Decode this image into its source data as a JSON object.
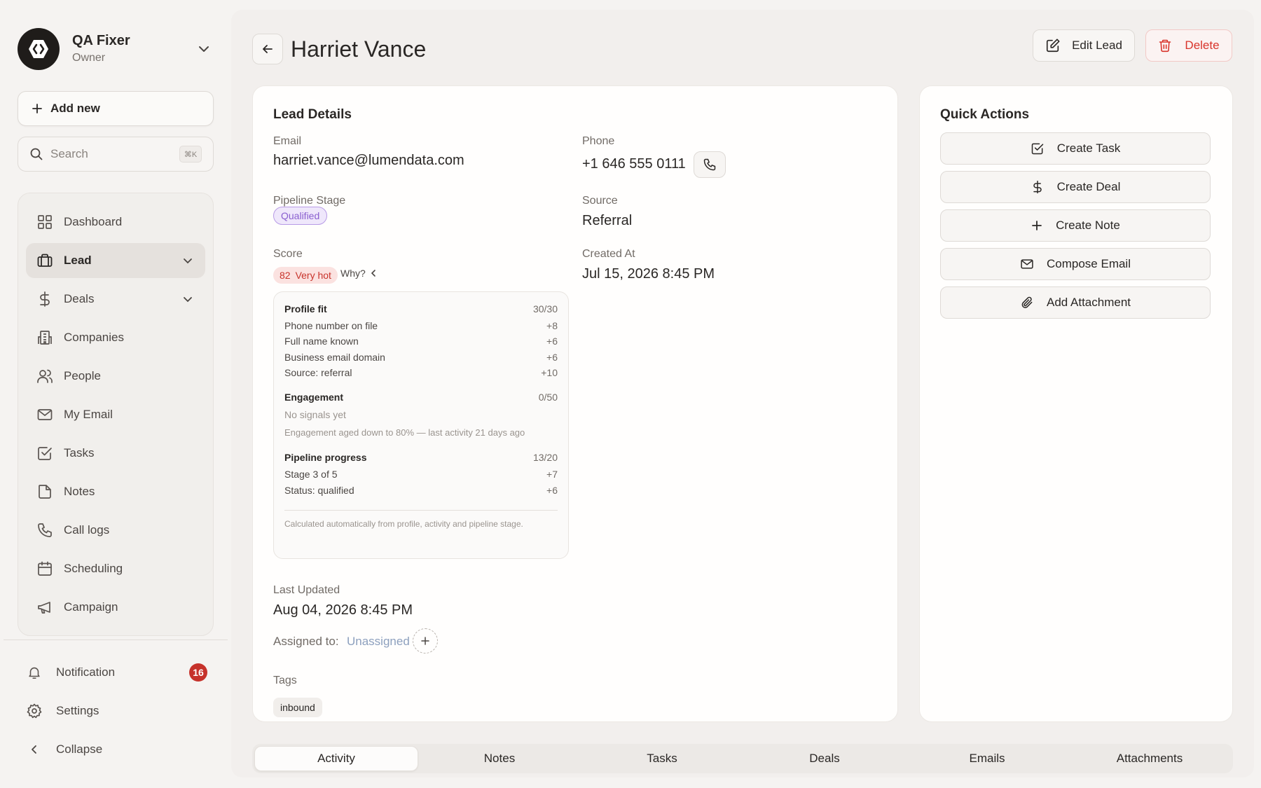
{
  "workspace": {
    "name": "QA Fixer",
    "role": "Owner"
  },
  "sidebar": {
    "add_new_label": "Add new",
    "search_placeholder": "Search",
    "search_shortcut": "⌘K",
    "items": [
      {
        "label": "Dashboard",
        "icon": "dashboard-icon"
      },
      {
        "label": "Lead",
        "icon": "briefcase-icon",
        "active": true
      },
      {
        "label": "Deals",
        "icon": "dollar-icon"
      },
      {
        "label": "Companies",
        "icon": "building-icon"
      },
      {
        "label": "People",
        "icon": "people-icon"
      },
      {
        "label": "My Email",
        "icon": "mail-icon"
      },
      {
        "label": "Tasks",
        "icon": "checkbox-icon"
      },
      {
        "label": "Notes",
        "icon": "note-icon"
      },
      {
        "label": "Call logs",
        "icon": "phone-icon"
      },
      {
        "label": "Scheduling",
        "icon": "calendar-icon"
      },
      {
        "label": "Campaign",
        "icon": "megaphone-icon"
      }
    ],
    "notification_label": "Notification",
    "notification_count": "16",
    "settings_label": "Settings",
    "collapse_label": "Collapse"
  },
  "header": {
    "title": "Harriet Vance",
    "edit_label": "Edit Lead",
    "delete_label": "Delete"
  },
  "lead_details": {
    "title": "Lead Details",
    "email_label": "Email",
    "email": "harriet.vance@lumendata.com",
    "phone_label": "Phone",
    "phone": "+1 646 555 0111",
    "stage_label": "Pipeline Stage",
    "stage": "Qualified",
    "source_label": "Source",
    "source": "Referral",
    "score_label": "Score",
    "score_value": "82",
    "score_text": "Very hot",
    "why_label": "Why?",
    "created_label": "Created At",
    "created": "Jul 15, 2026 8:45 PM",
    "breakdown": {
      "profile": {
        "title": "Profile fit",
        "points": "30/30",
        "rows": [
          {
            "label": "Phone number on file",
            "points": "+8"
          },
          {
            "label": "Full name known",
            "points": "+6"
          },
          {
            "label": "Business email domain",
            "points": "+6"
          },
          {
            "label": "Source: referral",
            "points": "+10"
          }
        ]
      },
      "engagement": {
        "title": "Engagement",
        "points": "0/50",
        "note1": "No signals yet",
        "note2": "Engagement aged down to 80% — last activity 21 days ago"
      },
      "pipeline": {
        "title": "Pipeline progress",
        "points": "13/20",
        "rows": [
          {
            "label": "Stage 3 of 5",
            "points": "+7"
          },
          {
            "label": "Status: qualified",
            "points": "+6"
          }
        ]
      },
      "footer": "Calculated automatically from profile, activity and pipeline stage."
    },
    "updated_label": "Last Updated",
    "updated": "Aug 04, 2026 8:45 PM",
    "assigned_label": "Assigned to:",
    "assigned": "Unassigned",
    "tags_label": "Tags",
    "tags": [
      "inbound"
    ]
  },
  "quick_actions": {
    "title": "Quick Actions",
    "items": [
      {
        "label": "Create Task",
        "icon": "checkbox-icon"
      },
      {
        "label": "Create Deal",
        "icon": "dollar-icon"
      },
      {
        "label": "Create Note",
        "icon": "plus-icon"
      },
      {
        "label": "Compose Email",
        "icon": "mail-icon"
      },
      {
        "label": "Add Attachment",
        "icon": "paperclip-icon"
      }
    ]
  },
  "tabs": [
    {
      "label": "Activity",
      "active": true
    },
    {
      "label": "Notes"
    },
    {
      "label": "Tasks"
    },
    {
      "label": "Deals"
    },
    {
      "label": "Emails"
    },
    {
      "label": "Attachments"
    }
  ],
  "colors": {
    "accent_red": "#d9342b",
    "badge_red": "#c6322b",
    "stage_purple": "#8a5fd0",
    "hot_red": "#c8342c"
  }
}
